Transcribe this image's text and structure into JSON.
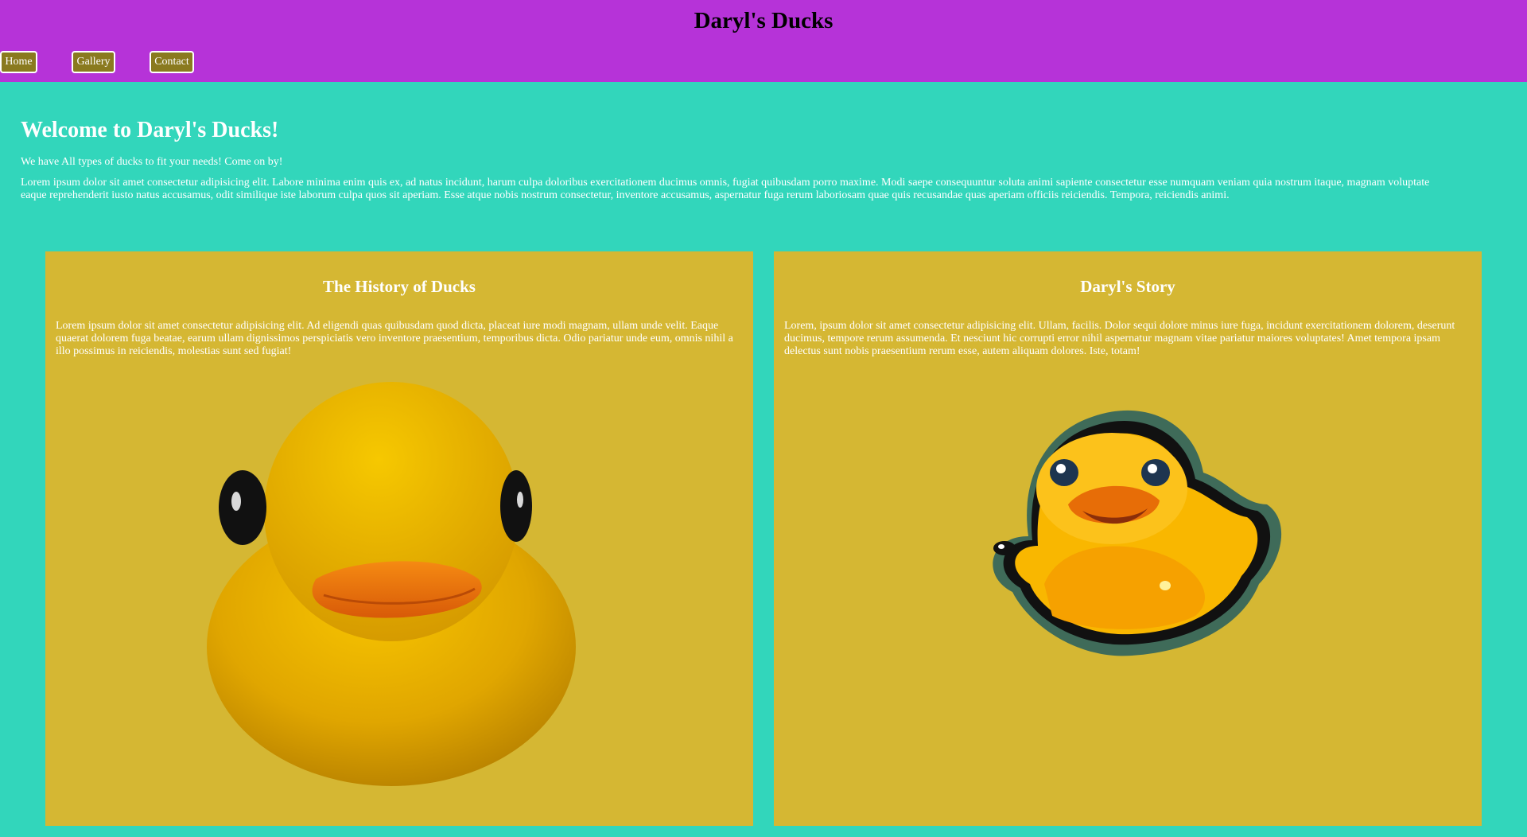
{
  "header": {
    "title": "Daryl's Ducks",
    "nav": [
      "Home",
      "Gallery",
      "Contact"
    ]
  },
  "welcome": {
    "heading": "Welcome to Daryl's Ducks!",
    "tagline": "We have All types of ducks to fit your needs! Come on by!",
    "body": "Lorem ipsum dolor sit amet consectetur adipisicing elit. Labore minima enim quis ex, ad natus incidunt, harum culpa doloribus exercitationem ducimus omnis, fugiat quibusdam porro maxime. Modi saepe consequuntur soluta animi sapiente consectetur esse numquam veniam quia nostrum itaque, magnam voluptate eaque reprehenderit iusto natus accusamus, odit similique iste laborum culpa quos sit aperiam. Esse atque nobis nostrum consectetur, inventore accusamus, aspernatur fuga rerum laboriosam quae quis recusandae quas aperiam officiis reiciendis. Tempora, reiciendis animi."
  },
  "cards": [
    {
      "title": "The History of Ducks",
      "body": "Lorem ipsum dolor sit amet consectetur adipisicing elit. Ad eligendi quas quibusdam quod dicta, placeat iure modi magnam, ullam unde velit. Eaque quaerat dolorem fuga beatae, earum ullam dignissimos perspiciatis vero inventore praesentium, temporibus dicta. Odio pariatur unde eum, omnis nihil a illo possimus in reiciendis, molestias sunt sed fugiat!"
    },
    {
      "title": "Daryl's Story",
      "body": "Lorem, ipsum dolor sit amet consectetur adipisicing elit. Ullam, facilis. Dolor sequi dolore minus iure fuga, incidunt exercitationem dolorem, deserunt ducimus, tempore rerum assumenda. Et nesciunt hic corrupti error nihil aspernatur magnam vitae pariatur maiores voluptates! Amet tempora ipsam delectus sunt nobis praesentium rerum esse, autem aliquam dolores. Iste, totam!"
    }
  ],
  "colors": {
    "header_bg": "#b633d8",
    "page_bg": "#32d6bb",
    "card_bg": "#d5b733",
    "nav_button_bg": "#8a7a1f"
  }
}
